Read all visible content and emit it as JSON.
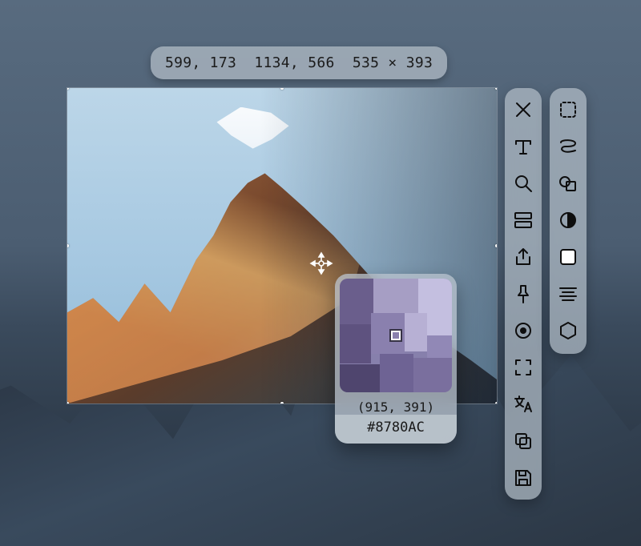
{
  "hud": {
    "text": "599, 173  1134, 566  535 × 393"
  },
  "picker": {
    "coords": "(915, 391)",
    "hex": "#8780AC"
  },
  "tools_left": {
    "close": "close-icon",
    "text": "text-tool-icon",
    "zoom": "magnifier-icon",
    "compare": "split-view-icon",
    "share": "share-icon",
    "pin": "pin-icon",
    "record": "record-icon",
    "fullscreen": "fullscreen-icon",
    "translate": "translate-icon",
    "copy": "copy-icon",
    "save": "save-icon"
  },
  "tools_right": {
    "marquee": "marquee-select-icon",
    "lasso": "lasso-icon",
    "shapes": "shapes-icon",
    "contrast": "contrast-circle-icon",
    "fill": "fill-square-icon",
    "align": "align-center-icon",
    "hexagon": "hexagon-icon"
  }
}
